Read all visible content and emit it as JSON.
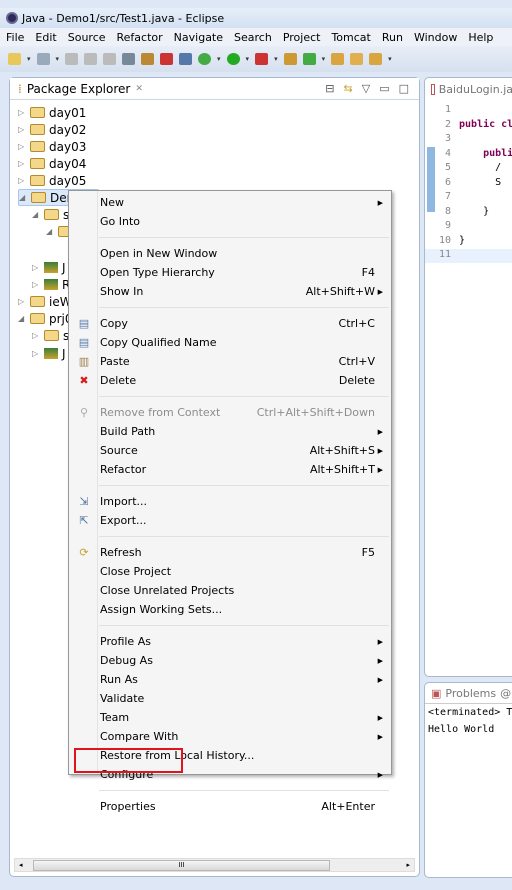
{
  "window": {
    "title": "Java - Demo1/src/Test1.java - Eclipse"
  },
  "menubar": [
    "File",
    "Edit",
    "Source",
    "Refactor",
    "Navigate",
    "Search",
    "Project",
    "Tomcat",
    "Run",
    "Window",
    "Help"
  ],
  "package_explorer": {
    "tab_label": "Package Explorer",
    "tree": [
      {
        "label": "day01",
        "expanded": false
      },
      {
        "label": "day02",
        "expanded": false
      },
      {
        "label": "day03",
        "expanded": false
      },
      {
        "label": "day04",
        "expanded": false
      },
      {
        "label": "day05",
        "expanded": false
      },
      {
        "label": "Dem",
        "expanded": true,
        "selected": true
      },
      {
        "label": "s",
        "expanded": true
      },
      {
        "label": "",
        "expanded": true
      },
      {
        "label": "J",
        "expanded": false
      },
      {
        "label": "R",
        "expanded": false
      },
      {
        "label": "ieWe",
        "expanded": false
      },
      {
        "label": "prj0",
        "expanded": true
      },
      {
        "label": "s",
        "expanded": false
      },
      {
        "label": "J",
        "expanded": false
      }
    ]
  },
  "editor": {
    "tab_label": "BaiduLogin.ja",
    "lines": [
      {
        "n": "1",
        "t": ""
      },
      {
        "n": "2",
        "t": "public cl"
      },
      {
        "n": "3",
        "t": ""
      },
      {
        "n": "4",
        "t": "    publi"
      },
      {
        "n": "5",
        "t": "      /"
      },
      {
        "n": "6",
        "t": "      S"
      },
      {
        "n": "7",
        "t": ""
      },
      {
        "n": "8",
        "t": "    }"
      },
      {
        "n": "9",
        "t": ""
      },
      {
        "n": "10",
        "t": "}"
      },
      {
        "n": "11",
        "t": ""
      }
    ]
  },
  "console": {
    "tab_label": "Problems",
    "tab2": "@",
    "terminated": "<terminated> Te",
    "output": "Hello World"
  },
  "context_menu": {
    "items": [
      {
        "label": "New",
        "submenu": true
      },
      {
        "label": "Go Into"
      },
      {
        "sep": true
      },
      {
        "label": "Open in New Window"
      },
      {
        "label": "Open Type Hierarchy",
        "shortcut": "F4"
      },
      {
        "label": "Show In",
        "shortcut": "Alt+Shift+W",
        "submenu": true
      },
      {
        "sep": true
      },
      {
        "label": "Copy",
        "shortcut": "Ctrl+C",
        "icon": "copy-icon"
      },
      {
        "label": "Copy Qualified Name",
        "icon": "copy-qualified-icon"
      },
      {
        "label": "Paste",
        "shortcut": "Ctrl+V",
        "icon": "paste-icon"
      },
      {
        "label": "Delete",
        "shortcut": "Delete",
        "icon": "delete-icon"
      },
      {
        "sep": true
      },
      {
        "label": "Remove from Context",
        "shortcut": "Ctrl+Alt+Shift+Down",
        "disabled": true,
        "icon": "remove-context-icon"
      },
      {
        "label": "Build Path",
        "submenu": true
      },
      {
        "label": "Source",
        "shortcut": "Alt+Shift+S",
        "submenu": true
      },
      {
        "label": "Refactor",
        "shortcut": "Alt+Shift+T",
        "submenu": true
      },
      {
        "sep": true
      },
      {
        "label": "Import...",
        "icon": "import-icon"
      },
      {
        "label": "Export...",
        "icon": "export-icon"
      },
      {
        "sep": true
      },
      {
        "label": "Refresh",
        "shortcut": "F5",
        "icon": "refresh-icon"
      },
      {
        "label": "Close Project"
      },
      {
        "label": "Close Unrelated Projects"
      },
      {
        "label": "Assign Working Sets..."
      },
      {
        "sep": true
      },
      {
        "label": "Profile As",
        "submenu": true
      },
      {
        "label": "Debug As",
        "submenu": true
      },
      {
        "label": "Run As",
        "submenu": true
      },
      {
        "label": "Validate"
      },
      {
        "label": "Team",
        "submenu": true
      },
      {
        "label": "Compare With",
        "submenu": true
      },
      {
        "label": "Restore from Local History..."
      },
      {
        "label": "Configure",
        "submenu": true
      },
      {
        "sep": true
      },
      {
        "label": "Properties",
        "shortcut": "Alt+Enter",
        "highlighted": true
      }
    ]
  },
  "colors": {
    "highlight_box": "#e0141c",
    "keyword": "#7f0055"
  }
}
